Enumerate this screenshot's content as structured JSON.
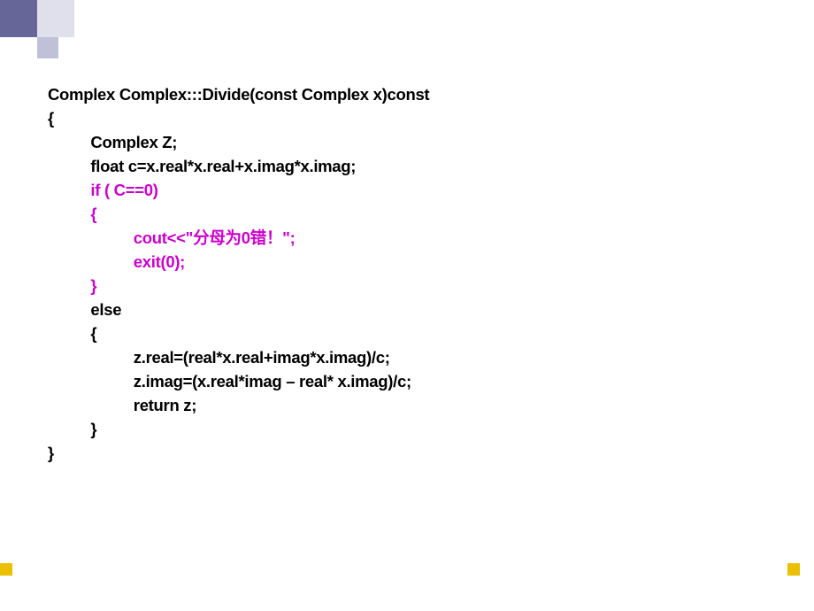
{
  "code": {
    "l1": "Complex Complex:::Divide(const Complex x)const",
    "l2": "{",
    "l3": "          Complex Z;",
    "l4": "          float c=x.real*x.real+x.imag*x.imag;",
    "l5": "          if ( C==0)",
    "l6": "          {",
    "l7a": "                    cout<<\"",
    "l7b": "分母为",
    "l7c": "0",
    "l7d": "错！",
    "l7e": "\";",
    "l8": "                    exit(0);",
    "l9": "          }",
    "l10": "          else",
    "l11": "          {",
    "l12": "                    z.real=(real*x.real+imag*x.imag)/c;",
    "l13": "                    z.imag=(x.real*imag – real* x.imag)/c;",
    "l14": "                    return z;",
    "l15": "          }",
    "l16": "}"
  }
}
